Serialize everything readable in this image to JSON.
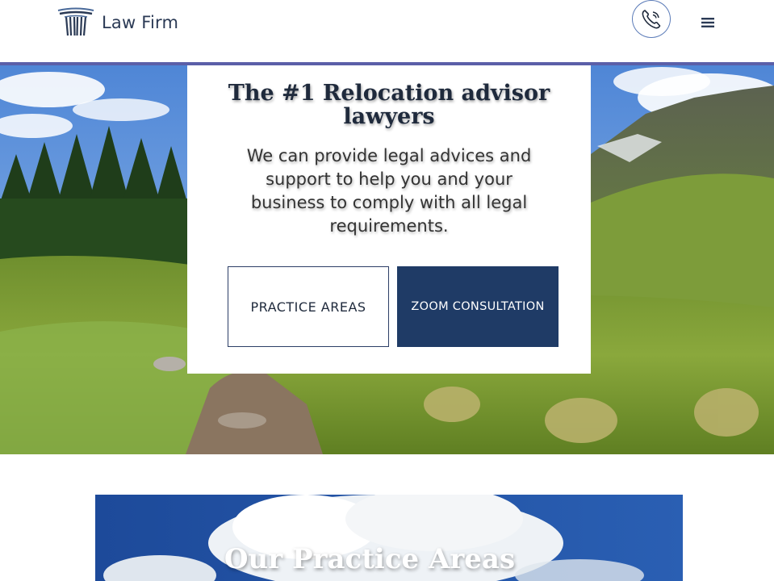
{
  "header": {
    "logo_text": "Law Firm",
    "logo_icon": "pillar-icon",
    "phone_icon": "phone-icon",
    "menu_icon": "hamburger-menu-icon",
    "accent_color": "#5b5fa8"
  },
  "hero": {
    "title_pre": "The #",
    "title_num": "1",
    "title_post": " Relocation advisor lawyers",
    "subtitle": "We can provide legal advices and support to help you and your business to comply with all legal requirements.",
    "practice_button": "PRACTICE AREAS",
    "zoom_button": "ZOOM CONSULTATION",
    "zoom_button_color": "#1f3b66"
  },
  "practice": {
    "title": "Our Practice Areas"
  }
}
